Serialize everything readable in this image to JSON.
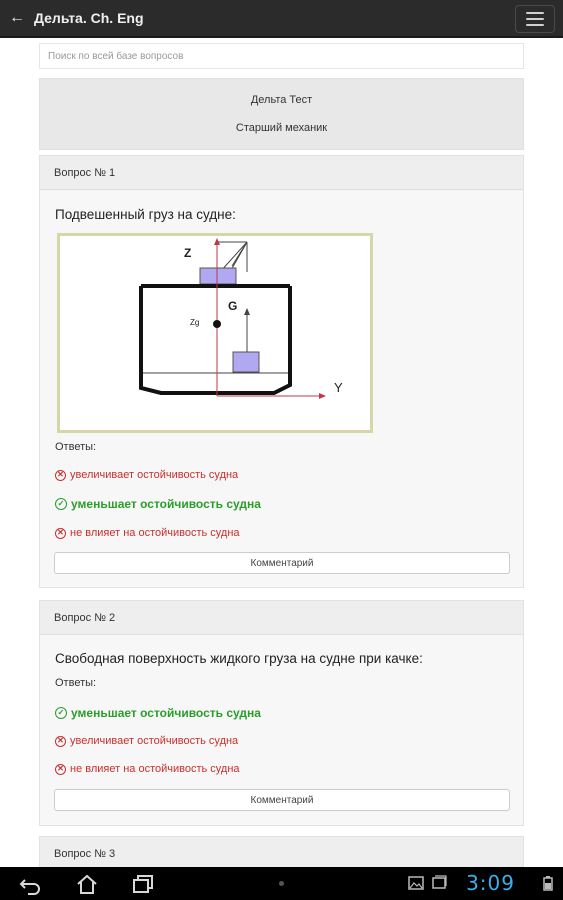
{
  "appbar": {
    "title": "Дельта. Ch. Eng"
  },
  "search": {
    "placeholder": "Поиск по всей базе вопросов"
  },
  "info": {
    "test_name": "Дельта Тест",
    "position": "Старший механик"
  },
  "questions": [
    {
      "header": "Вопрос № 1",
      "text": "Подвешенный груз на судне:",
      "diagram": {
        "label_z": "Z",
        "label_y": "Y",
        "label_g": "G",
        "label_zg": "Zg"
      },
      "answers_label": "Ответы:",
      "answers": [
        {
          "text": "увеличивает остойчивость судна",
          "correct": false
        },
        {
          "text": "уменьшает остойчивость судна",
          "correct": true
        },
        {
          "text": "не влияет на остойчивость судна",
          "correct": false
        }
      ],
      "comment_label": "Комментарий"
    },
    {
      "header": "Вопрос № 2",
      "text": "Свободная поверхность жидкого груза на судне при качке:",
      "answers_label": "Ответы:",
      "answers": [
        {
          "text": "уменьшает остойчивость судна",
          "correct": true
        },
        {
          "text": "увеличивает остойчивость судна",
          "correct": false
        },
        {
          "text": "не влияет на остойчивость судна",
          "correct": false
        }
      ],
      "comment_label": "Комментарий"
    },
    {
      "header": "Вопрос № 3"
    }
  ],
  "navbar": {
    "time": "3:09"
  },
  "colors": {
    "correct": "#2a9d2a",
    "wrong": "#c9302c",
    "clock": "#3bb0e8"
  }
}
